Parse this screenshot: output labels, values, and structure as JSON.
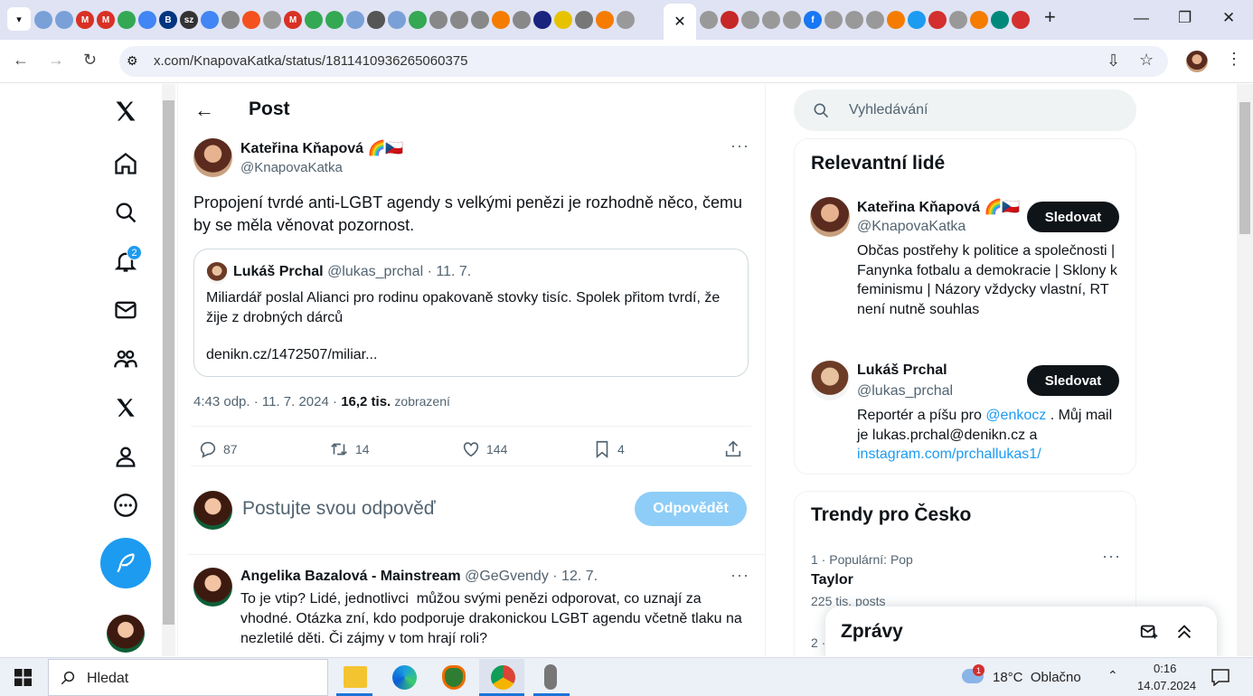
{
  "browser": {
    "active_tab_close": "✕",
    "new_tab": "+",
    "url": "x.com/KnapovaKatka/status/1811410936265060375",
    "window_controls": {
      "minimize": "—",
      "restore": "❐",
      "close": "✕"
    }
  },
  "nav": {
    "notifications_badge": "2"
  },
  "post": {
    "header_title": "Post",
    "author_name": "Kateřina Kňapová 🌈🇨🇿",
    "author_handle": "@KnapovaKatka",
    "text": "Propojení tvrdé anti-LGBT agendy s velkými penězi je rozhodně něco, čemu by se měla věnovat pozornost.",
    "quote": {
      "author_name": "Lukáš Prchal",
      "author_handle": "@lukas_prchal",
      "date": "· 11. 7.",
      "text": "Miliardář poslal Alianci pro rodinu opakovaně stovky tisíc. Spolek přitom tvrdí, že žije z drobných dárců",
      "link": "denikn.cz/1472507/miliar..."
    },
    "meta_time": "4:43 odp. · 11. 7. 2024 ·",
    "meta_views": "16,2 tis.",
    "meta_views_label": "zobrazení",
    "stats": {
      "replies": "87",
      "reposts": "14",
      "likes": "144",
      "bookmarks": "4"
    }
  },
  "reply_box": {
    "placeholder": "Postujte svou odpověď",
    "button": "Odpovědět"
  },
  "reply": {
    "author_name": "Angelika Bazalová - Mainstream",
    "author_handle": "@GeGvendy",
    "date": "· 12. 7.",
    "text": "To je vtip? Lidé, jednotlivci  můžou svými penězi odporovat, co uznají za vhodné. Otázka zní, kdo podporuje drakonickou LGBT agendu včetně tlaku na nezletilé děti. Či zájmy v tom hrají roli?"
  },
  "sidebar": {
    "search_placeholder": "Vyhledávání",
    "people_title": "Relevantní lidé",
    "people": [
      {
        "name": "Kateřina Kňapová 🌈🇨🇿",
        "handle": "@KnapovaKatka",
        "follow": "Sledovat",
        "bio": "Občas postřehy k politice a společnosti | Fanynka fotbalu a demokracie | Sklony k feminismu | Názory vždycky vlastní, RT není nutně souhlas"
      },
      {
        "name": "Lukáš Prchal",
        "handle": "@lukas_prchal",
        "follow": "Sledovat",
        "bio_prefix": "Reportér a píšu pro",
        "bio_mention": "@enkocz",
        "bio_mid": ". Můj mail je lukas.prchal@denikn.cz a",
        "bio_link": "instagram.com/prchallukas1/"
      }
    ],
    "trends_title": "Trendy pro Česko",
    "trends": [
      {
        "meta": "1 · Populární: Pop",
        "name": "Taylor",
        "count": "225 tis. posts"
      },
      {
        "meta": "2 ·"
      }
    ],
    "messages_title": "Zprávy"
  },
  "taskbar": {
    "search": "Hledat",
    "weather": "18°C  Oblačno",
    "weather_badge": "1",
    "time": "0:16",
    "date": "14.07.2024"
  }
}
